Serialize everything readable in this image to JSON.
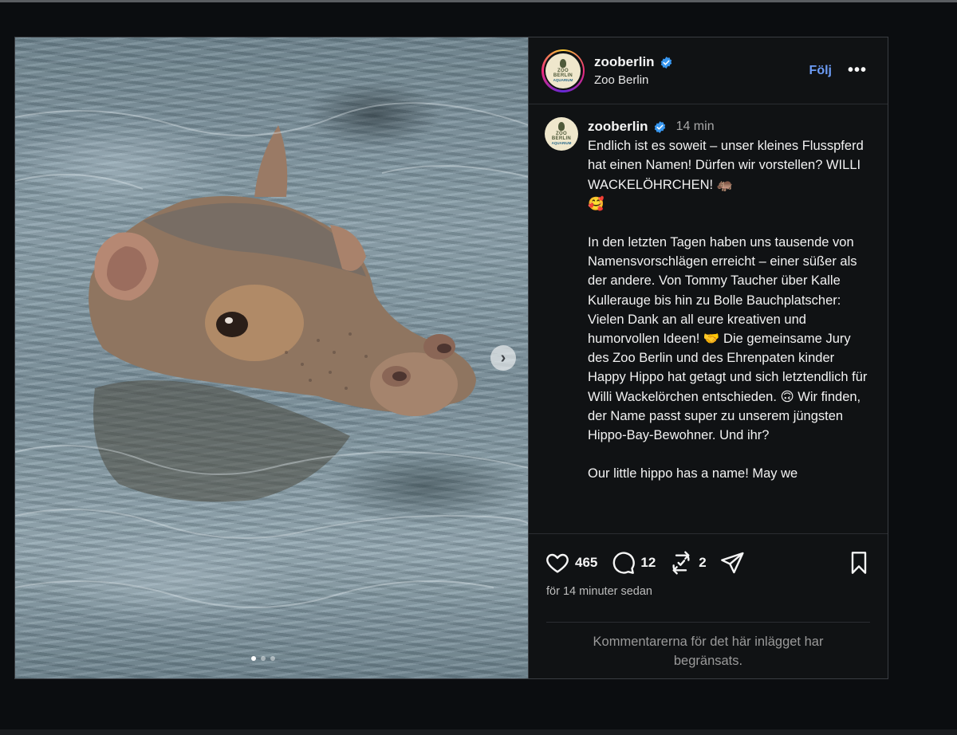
{
  "post": {
    "username": "zooberlin",
    "display_name": "Zoo Berlin",
    "follow_label": "Följ",
    "more_label": "•••",
    "avatar_text": {
      "line1": "ZOO",
      "line2": "BERLIN",
      "line3": "AQUARIUM"
    },
    "media": {
      "next_label": "›",
      "image_icon": "hippo-photo",
      "slide_count": 3,
      "active_slide": 1
    },
    "caption": {
      "time": "14 min",
      "paragraph1": "Endlich ist es soweit – unser kleines Flusspferd hat einen Namen! Dürfen wir vorstellen? WILLI WACKELÖHRCHEN! 🦛\n🥰",
      "paragraph2": "In den letzten Tagen haben uns tausende von Namensvorschlägen erreicht – einer süßer als der andere. Von Tommy Taucher über Kalle Kullerauge bis hin zu Bolle Bauchplatscher: Vielen Dank an all eure kreativen und humorvollen Ideen! 🤝 Die gemeinsame Jury des Zoo Berlin und des Ehrenpaten kinder Happy Hippo hat getagt und sich letztendlich für Willi Wackelörchen entschieden. 🙃 Wir finden, der Name passt super zu unserem jüngsten Hippo-Bay-Bewohner. Und ihr?",
      "paragraph3": "Our little hippo has a name! May we"
    },
    "actions": {
      "likes": "465",
      "comments": "12",
      "reposts": "2"
    },
    "timestamp": "för 14 minuter sedan",
    "restricted_notice": "Kommentarerna för det här inlägget har begränsats."
  },
  "colors": {
    "accent": "#6d9cf6",
    "verified": "#3897f0",
    "background": "#101214"
  }
}
